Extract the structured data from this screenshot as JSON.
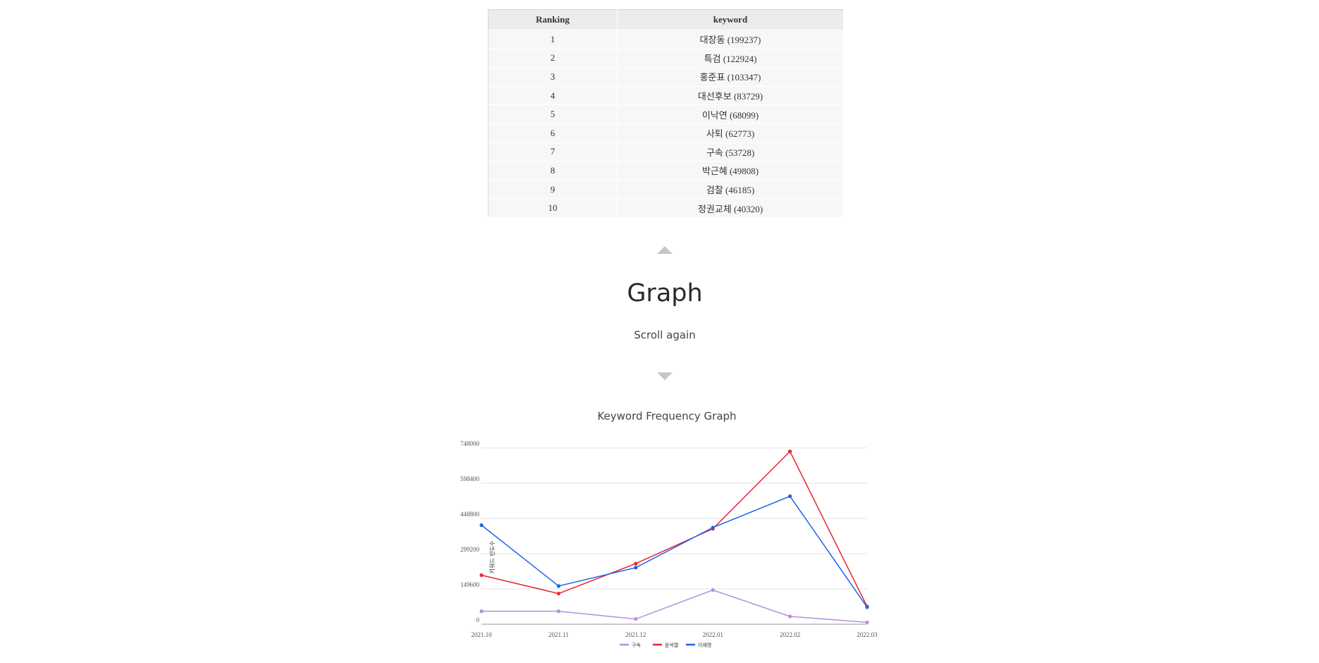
{
  "table": {
    "headers": [
      "Ranking",
      "keyword"
    ],
    "rows": [
      [
        "1",
        "대장동 (199237)"
      ],
      [
        "2",
        "특검 (122924)"
      ],
      [
        "3",
        "홍준표 (103347)"
      ],
      [
        "4",
        "대선후보 (83729)"
      ],
      [
        "5",
        "이낙연 (68099)"
      ],
      [
        "6",
        "사퇴 (62773)"
      ],
      [
        "7",
        "구속 (53728)"
      ],
      [
        "8",
        "박근혜 (49808)"
      ],
      [
        "9",
        "검찰 (46185)"
      ],
      [
        "10",
        "정권교체 (40320)"
      ]
    ]
  },
  "section": {
    "title": "Graph",
    "subtitle": "Scroll again"
  },
  "icons": {
    "up": "triangle-up-icon",
    "down": "triangle-down-icon"
  },
  "chart_data": {
    "type": "line",
    "title": "Keyword Frequency Graph",
    "xlabel": "",
    "ylabel": "키워드 빈도수",
    "categories": [
      "2021.10",
      "2021.11",
      "2021.12",
      "2022.01",
      "2022.02",
      "2022.03"
    ],
    "yticks": [
      0,
      149600,
      299200,
      448800,
      598400,
      748000
    ],
    "ylim": [
      0,
      748000
    ],
    "grid": true,
    "legend_position": "bottom",
    "series": [
      {
        "name": "구속",
        "color": "#b48ee0",
        "values": [
          55000,
          55000,
          22000,
          145000,
          33000,
          8000
        ]
      },
      {
        "name": "윤석열",
        "color": "#e8252f",
        "values": [
          208000,
          130000,
          257000,
          405000,
          733000,
          75000
        ]
      },
      {
        "name": "이재명",
        "color": "#1e64e6",
        "values": [
          420000,
          162000,
          240000,
          410000,
          543000,
          72000
        ]
      }
    ]
  }
}
